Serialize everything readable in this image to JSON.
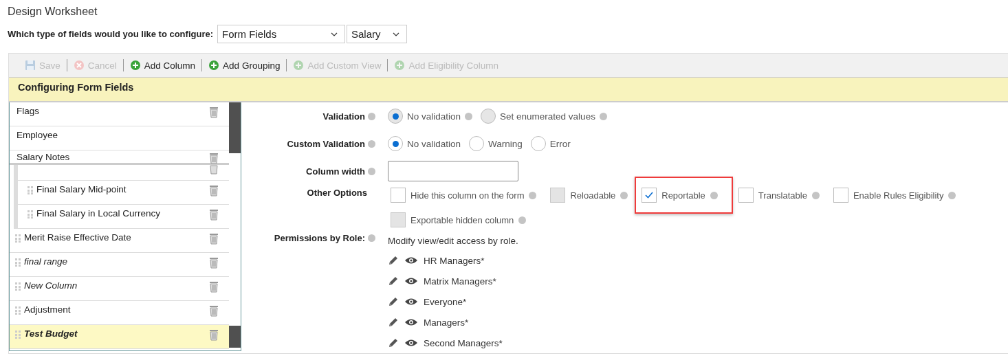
{
  "page_title": "Design Worksheet",
  "config": {
    "label": "Which type of fields would you like to configure:",
    "field_type": "Form Fields",
    "template": "Salary"
  },
  "toolbar": [
    {
      "label": "Save",
      "kind": "save",
      "disabled": true
    },
    {
      "label": "Cancel",
      "kind": "cancel",
      "disabled": true
    },
    {
      "label": "Add Column",
      "kind": "add",
      "disabled": false
    },
    {
      "label": "Add Grouping",
      "kind": "add",
      "disabled": false
    },
    {
      "label": "Add Custom View",
      "kind": "add",
      "disabled": true
    },
    {
      "label": "Add Eligibility Column",
      "kind": "add",
      "disabled": true
    }
  ],
  "section_title": "Configuring Form Fields",
  "columns": [
    {
      "label": "Flags",
      "italic": false,
      "selected": false,
      "deletable": true,
      "draggable": false
    },
    {
      "label": "Employee",
      "italic": false,
      "selected": false,
      "deletable": false,
      "draggable": false
    },
    {
      "label": "Salary Notes",
      "italic": false,
      "selected": false,
      "deletable": true,
      "draggable": false,
      "children": [
        {
          "label": "Final Salary Mid-point",
          "italic": false,
          "selected": false,
          "deletable": true,
          "draggable": true
        },
        {
          "label": "Final Salary in Local Currency",
          "italic": false,
          "selected": false,
          "deletable": true,
          "draggable": true
        }
      ]
    },
    {
      "label": "Merit Raise Effective Date",
      "italic": false,
      "selected": false,
      "deletable": true,
      "draggable": true
    },
    {
      "label": "final range",
      "italic": true,
      "selected": false,
      "deletable": true,
      "draggable": true
    },
    {
      "label": "New Column",
      "italic": true,
      "selected": false,
      "deletable": true,
      "draggable": true
    },
    {
      "label": "Adjustment",
      "italic": false,
      "selected": false,
      "deletable": true,
      "draggable": true
    },
    {
      "label": "Test Budget",
      "italic": true,
      "selected": true,
      "deletable": true,
      "draggable": true
    }
  ],
  "form": {
    "validation": {
      "label": "Validation",
      "options": [
        {
          "label": "No validation",
          "selected": true,
          "disabled": true,
          "help": true
        },
        {
          "label": "Set enumerated values",
          "selected": false,
          "disabled": true,
          "help": true
        }
      ]
    },
    "custom_validation": {
      "label": "Custom Validation",
      "options": [
        {
          "label": "No validation",
          "selected": true,
          "disabled": false,
          "help": false
        },
        {
          "label": "Warning",
          "selected": false,
          "disabled": false,
          "help": false
        },
        {
          "label": "Error",
          "selected": false,
          "disabled": false,
          "help": false
        }
      ]
    },
    "column_width": {
      "label": "Column width"
    },
    "other_options": {
      "label": "Other Options",
      "options": [
        {
          "label": "Hide this column on the form",
          "checked": false,
          "disabled": false,
          "highlighted": false
        },
        {
          "label": "Reloadable",
          "checked": false,
          "disabled": true,
          "highlighted": false
        },
        {
          "label": "Reportable",
          "checked": true,
          "disabled": false,
          "highlighted": true
        },
        {
          "label": "Translatable",
          "checked": false,
          "disabled": false,
          "highlighted": false
        },
        {
          "label": "Enable Rules Eligibility",
          "checked": false,
          "disabled": false,
          "highlighted": false
        },
        {
          "label": "Exportable hidden column",
          "checked": false,
          "disabled": true,
          "highlighted": false
        }
      ]
    },
    "permissions": {
      "label": "Permissions by Role:",
      "description": "Modify view/edit access by role.",
      "roles": [
        "HR Managers*",
        "Matrix Managers*",
        "Everyone*",
        "Managers*",
        "Second Managers*"
      ]
    }
  }
}
